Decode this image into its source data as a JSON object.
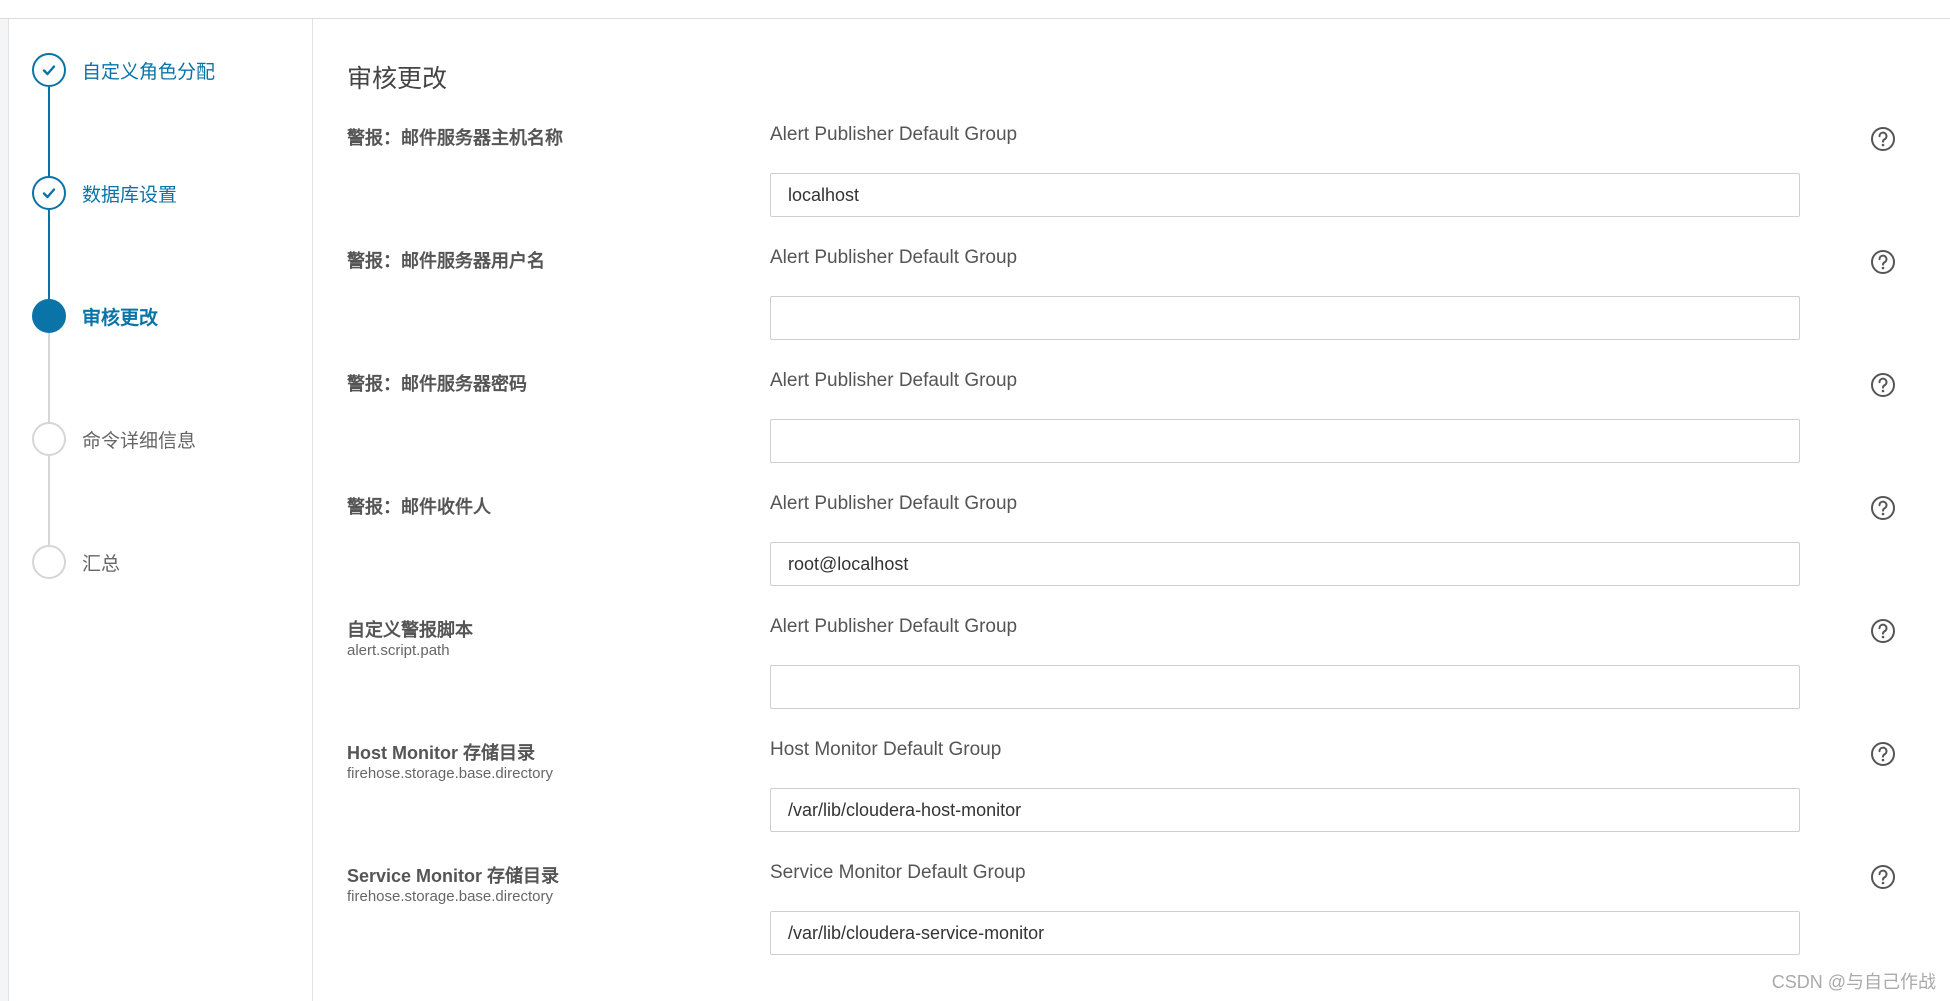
{
  "sidebar": {
    "steps": [
      {
        "label": "自定义角色分配",
        "state": "done"
      },
      {
        "label": "数据库设置",
        "state": "done"
      },
      {
        "label": "审核更改",
        "state": "active"
      },
      {
        "label": "命令详细信息",
        "state": "todo"
      },
      {
        "label": "汇总",
        "state": "todo"
      }
    ]
  },
  "main": {
    "title": "审核更改",
    "rows": [
      {
        "name": "警报：邮件服务器主机名称",
        "key": "",
        "group": "Alert Publisher Default Group",
        "value": "localhost"
      },
      {
        "name": "警报：邮件服务器用户名",
        "key": "",
        "group": "Alert Publisher Default Group",
        "value": ""
      },
      {
        "name": "警报：邮件服务器密码",
        "key": "",
        "group": "Alert Publisher Default Group",
        "value": ""
      },
      {
        "name": "警报：邮件收件人",
        "key": "",
        "group": "Alert Publisher Default Group",
        "value": "root@localhost"
      },
      {
        "name": "自定义警报脚本",
        "key": "alert.script.path",
        "group": "Alert Publisher Default Group",
        "value": ""
      },
      {
        "name": "Host Monitor 存储目录",
        "key": "firehose.storage.base.directory",
        "group": "Host Monitor Default Group",
        "value": "/var/lib/cloudera-host-monitor"
      },
      {
        "name": "Service Monitor 存储目录",
        "key": "firehose.storage.base.directory",
        "group": "Service Monitor Default Group",
        "value": "/var/lib/cloudera-service-monitor"
      }
    ]
  },
  "icons": {
    "step_done": "check-icon",
    "help": "question-circle-icon"
  },
  "colors": {
    "accent": "#0a74a8",
    "todo": "#d6d6d6"
  },
  "watermark": "CSDN @与自己作战"
}
